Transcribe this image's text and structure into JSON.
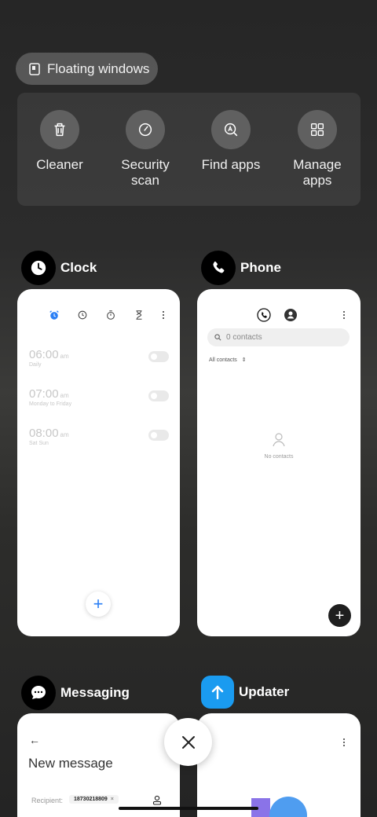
{
  "floating_windows": {
    "label": "Floating windows"
  },
  "tools": [
    {
      "label": "Cleaner",
      "icon": "trash-icon"
    },
    {
      "label": "Security\nscan",
      "icon": "security-scan-icon"
    },
    {
      "label": "Find apps",
      "icon": "find-apps-icon"
    },
    {
      "label": "Manage\napps",
      "icon": "grid-icon"
    }
  ],
  "apps": {
    "clock": {
      "name": "Clock",
      "alarms": [
        {
          "time": "06:00",
          "ampm": "am",
          "repeat": "Daily"
        },
        {
          "time": "07:00",
          "ampm": "am",
          "repeat": "Monday to Friday"
        },
        {
          "time": "08:00",
          "ampm": "am",
          "repeat": "Sat Sun"
        }
      ],
      "add_label": "+"
    },
    "phone": {
      "name": "Phone",
      "search_placeholder": "0 contacts",
      "filter_label": "All contacts",
      "empty_label": "No contacts",
      "add_label": "+"
    },
    "messaging": {
      "name": "Messaging",
      "title": "New message",
      "recipient_label": "Recipient:",
      "recipient_chip": "18730218809"
    },
    "updater": {
      "name": "Updater"
    }
  },
  "colors": {
    "accent_blue": "#2a7ff5",
    "updater_blue": "#1a9bf0"
  }
}
